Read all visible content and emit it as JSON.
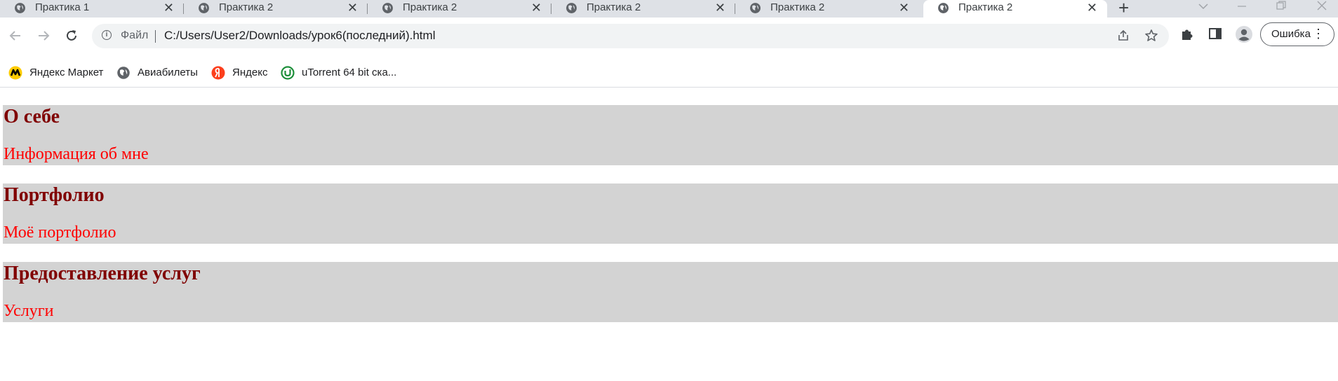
{
  "browser": {
    "tabs": [
      {
        "title": "Практика 1",
        "active": false
      },
      {
        "title": "Практика 2",
        "active": false
      },
      {
        "title": "Практика 2",
        "active": false
      },
      {
        "title": "Практика 2",
        "active": false
      },
      {
        "title": "Практика 2",
        "active": false
      },
      {
        "title": "Практика 2",
        "active": true
      }
    ],
    "tab_close_glyph": "✕",
    "new_tab_glyph": "+",
    "address": {
      "scheme_label": "Файл",
      "url": "C:/Users/User2/Downloads/урок6(последний).html"
    },
    "error_button_label": "Ошибка",
    "menu_glyph": "⋮",
    "bookmarks": [
      {
        "label": "Яндекс Маркет",
        "icon": "yandex-market-icon"
      },
      {
        "label": "Авиабилеты",
        "icon": "globe-icon"
      },
      {
        "label": "Яндекс",
        "icon": "yandex-icon"
      },
      {
        "label": "uTorrent 64 bit ска...",
        "icon": "utorrent-icon"
      }
    ]
  },
  "page": {
    "sections": [
      {
        "heading": "О себе",
        "text": "Информация об мне"
      },
      {
        "heading": "Портфолио",
        "text": "Моё портфолио"
      },
      {
        "heading": "Предоставление услуг",
        "text": "Услуги"
      }
    ]
  },
  "colors": {
    "section_background": "#d3d3d3",
    "heading": "#800000",
    "body_text": "#ff0000",
    "tabstrip": "#dee1e6",
    "omnibox": "#f1f3f4"
  }
}
